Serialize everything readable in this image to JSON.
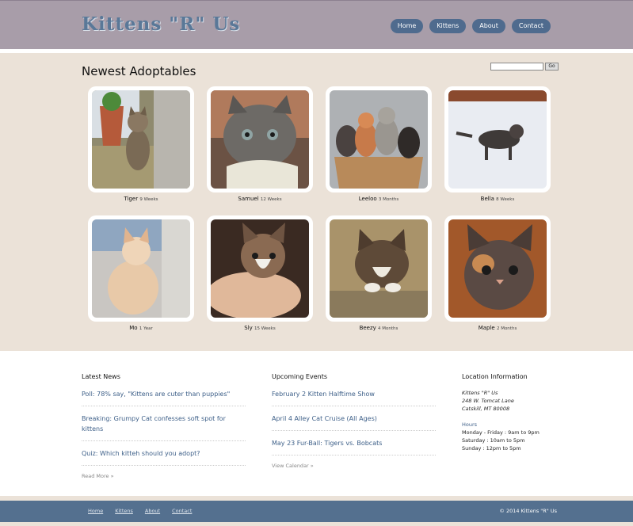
{
  "site": {
    "logo_text": "Kittens \"R\" Us"
  },
  "nav": [
    "Home",
    "Kittens",
    "About",
    "Contact"
  ],
  "search": {
    "value": "",
    "button_label": "Go"
  },
  "gallery": {
    "title": "Newest Adoptables",
    "kittens": [
      {
        "name": "Tiger",
        "age": "9 Weeks",
        "photo": "tabby kitten by flower pot"
      },
      {
        "name": "Samuel",
        "age": "12 Weeks",
        "photo": "grey tabby kitten on knit blanket"
      },
      {
        "name": "Leeloo",
        "age": "3 Months",
        "photo": "kittens in a basket"
      },
      {
        "name": "Bella",
        "age": "8 Weeks",
        "photo": "kitten in snow"
      },
      {
        "name": "Mo",
        "age": "1 Year",
        "photo": "cream and white cat by window"
      },
      {
        "name": "Sly",
        "age": "15 Weeks",
        "photo": "tabby white kitten in hands"
      },
      {
        "name": "Beezy",
        "age": "4 Months",
        "photo": "tabby kitten peeking over ledge"
      },
      {
        "name": "Maple",
        "age": "2 Months",
        "photo": "tortoiseshell kitten"
      }
    ]
  },
  "news": {
    "title": "Latest News",
    "items": [
      "Poll: 78% say, \"Kittens are cuter than puppies\"",
      "Breaking: Grumpy Cat confesses soft spot for kittens",
      "Quiz: Which kitteh should you adopt?"
    ],
    "more_label": "Read More »"
  },
  "events": {
    "title": "Upcoming Events",
    "items": [
      "February 2 Kitten Halftime Show",
      "April 4 Alley Cat Cruise (All Ages)",
      "May 23 Fur-Ball: Tigers vs. Bobcats"
    ],
    "more_label": "View Calendar »"
  },
  "location": {
    "title": "Location Information",
    "address": [
      "Kittens \"R\" Us",
      "248 W. Tomcat Lane",
      "Catskill, MT 80008"
    ],
    "hours_title": "Hours",
    "hours": [
      "Monday - Friday : 9am to 9pm",
      "Saturday : 10am to 5pm",
      "Sunday : 12pm to 5pm"
    ]
  },
  "footer": {
    "links": [
      "Home",
      "Kittens",
      "About",
      "Contact"
    ],
    "copyright": "© 2014 Kittens \"R\" Us"
  },
  "colors": {
    "header_bg": "#a89da9",
    "nav_pill": "#4f6b8e",
    "page_bg": "#ebe2d8",
    "link_blue": "#3d5f88",
    "footer_bg": "#54708f"
  }
}
